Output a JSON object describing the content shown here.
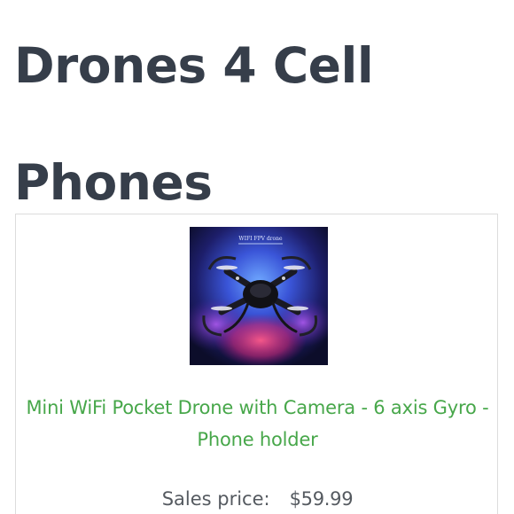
{
  "page": {
    "title": "Drones 4 Cell Phones"
  },
  "product": {
    "image_alt": "Mini WiFi Pocket Drone",
    "box_caption": "WIFI FPV drone",
    "name": "Mini WiFi Pocket Drone with Camera - 6 axis Gyro - Phone holder",
    "price_label": "Sales price:",
    "price": "$59.99"
  },
  "colors": {
    "title": "#363e4a",
    "link": "#47a74a",
    "price_text": "#555a60",
    "card_border": "#dcdcdc"
  }
}
